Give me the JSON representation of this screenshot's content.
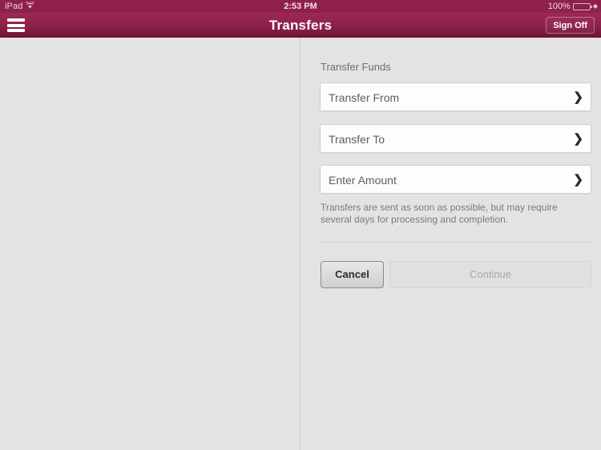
{
  "status_bar": {
    "device_label": "iPad",
    "wifi_icon": "wifi-icon",
    "time": "2:53 PM",
    "battery_percent": "100%",
    "battery_level": 100,
    "charging_icon": "plug-icon"
  },
  "nav_bar": {
    "menu_icon": "hamburger-menu-icon",
    "title": "Transfers",
    "sign_off_label": "Sign Off",
    "brand_color": "#8d2049"
  },
  "form": {
    "section_title": "Transfer Funds",
    "fields": [
      {
        "label": "Transfer From",
        "value": "",
        "chevron": "chevron-right-icon"
      },
      {
        "label": "Transfer To",
        "value": "",
        "chevron": "chevron-right-icon"
      },
      {
        "label": "Enter Amount",
        "value": "",
        "chevron": "chevron-right-icon"
      }
    ],
    "disclaimer": "Transfers are sent as soon as possible, but may require several days for processing and completion.",
    "cancel_label": "Cancel",
    "continue_label": "Continue",
    "continue_disabled": true
  }
}
